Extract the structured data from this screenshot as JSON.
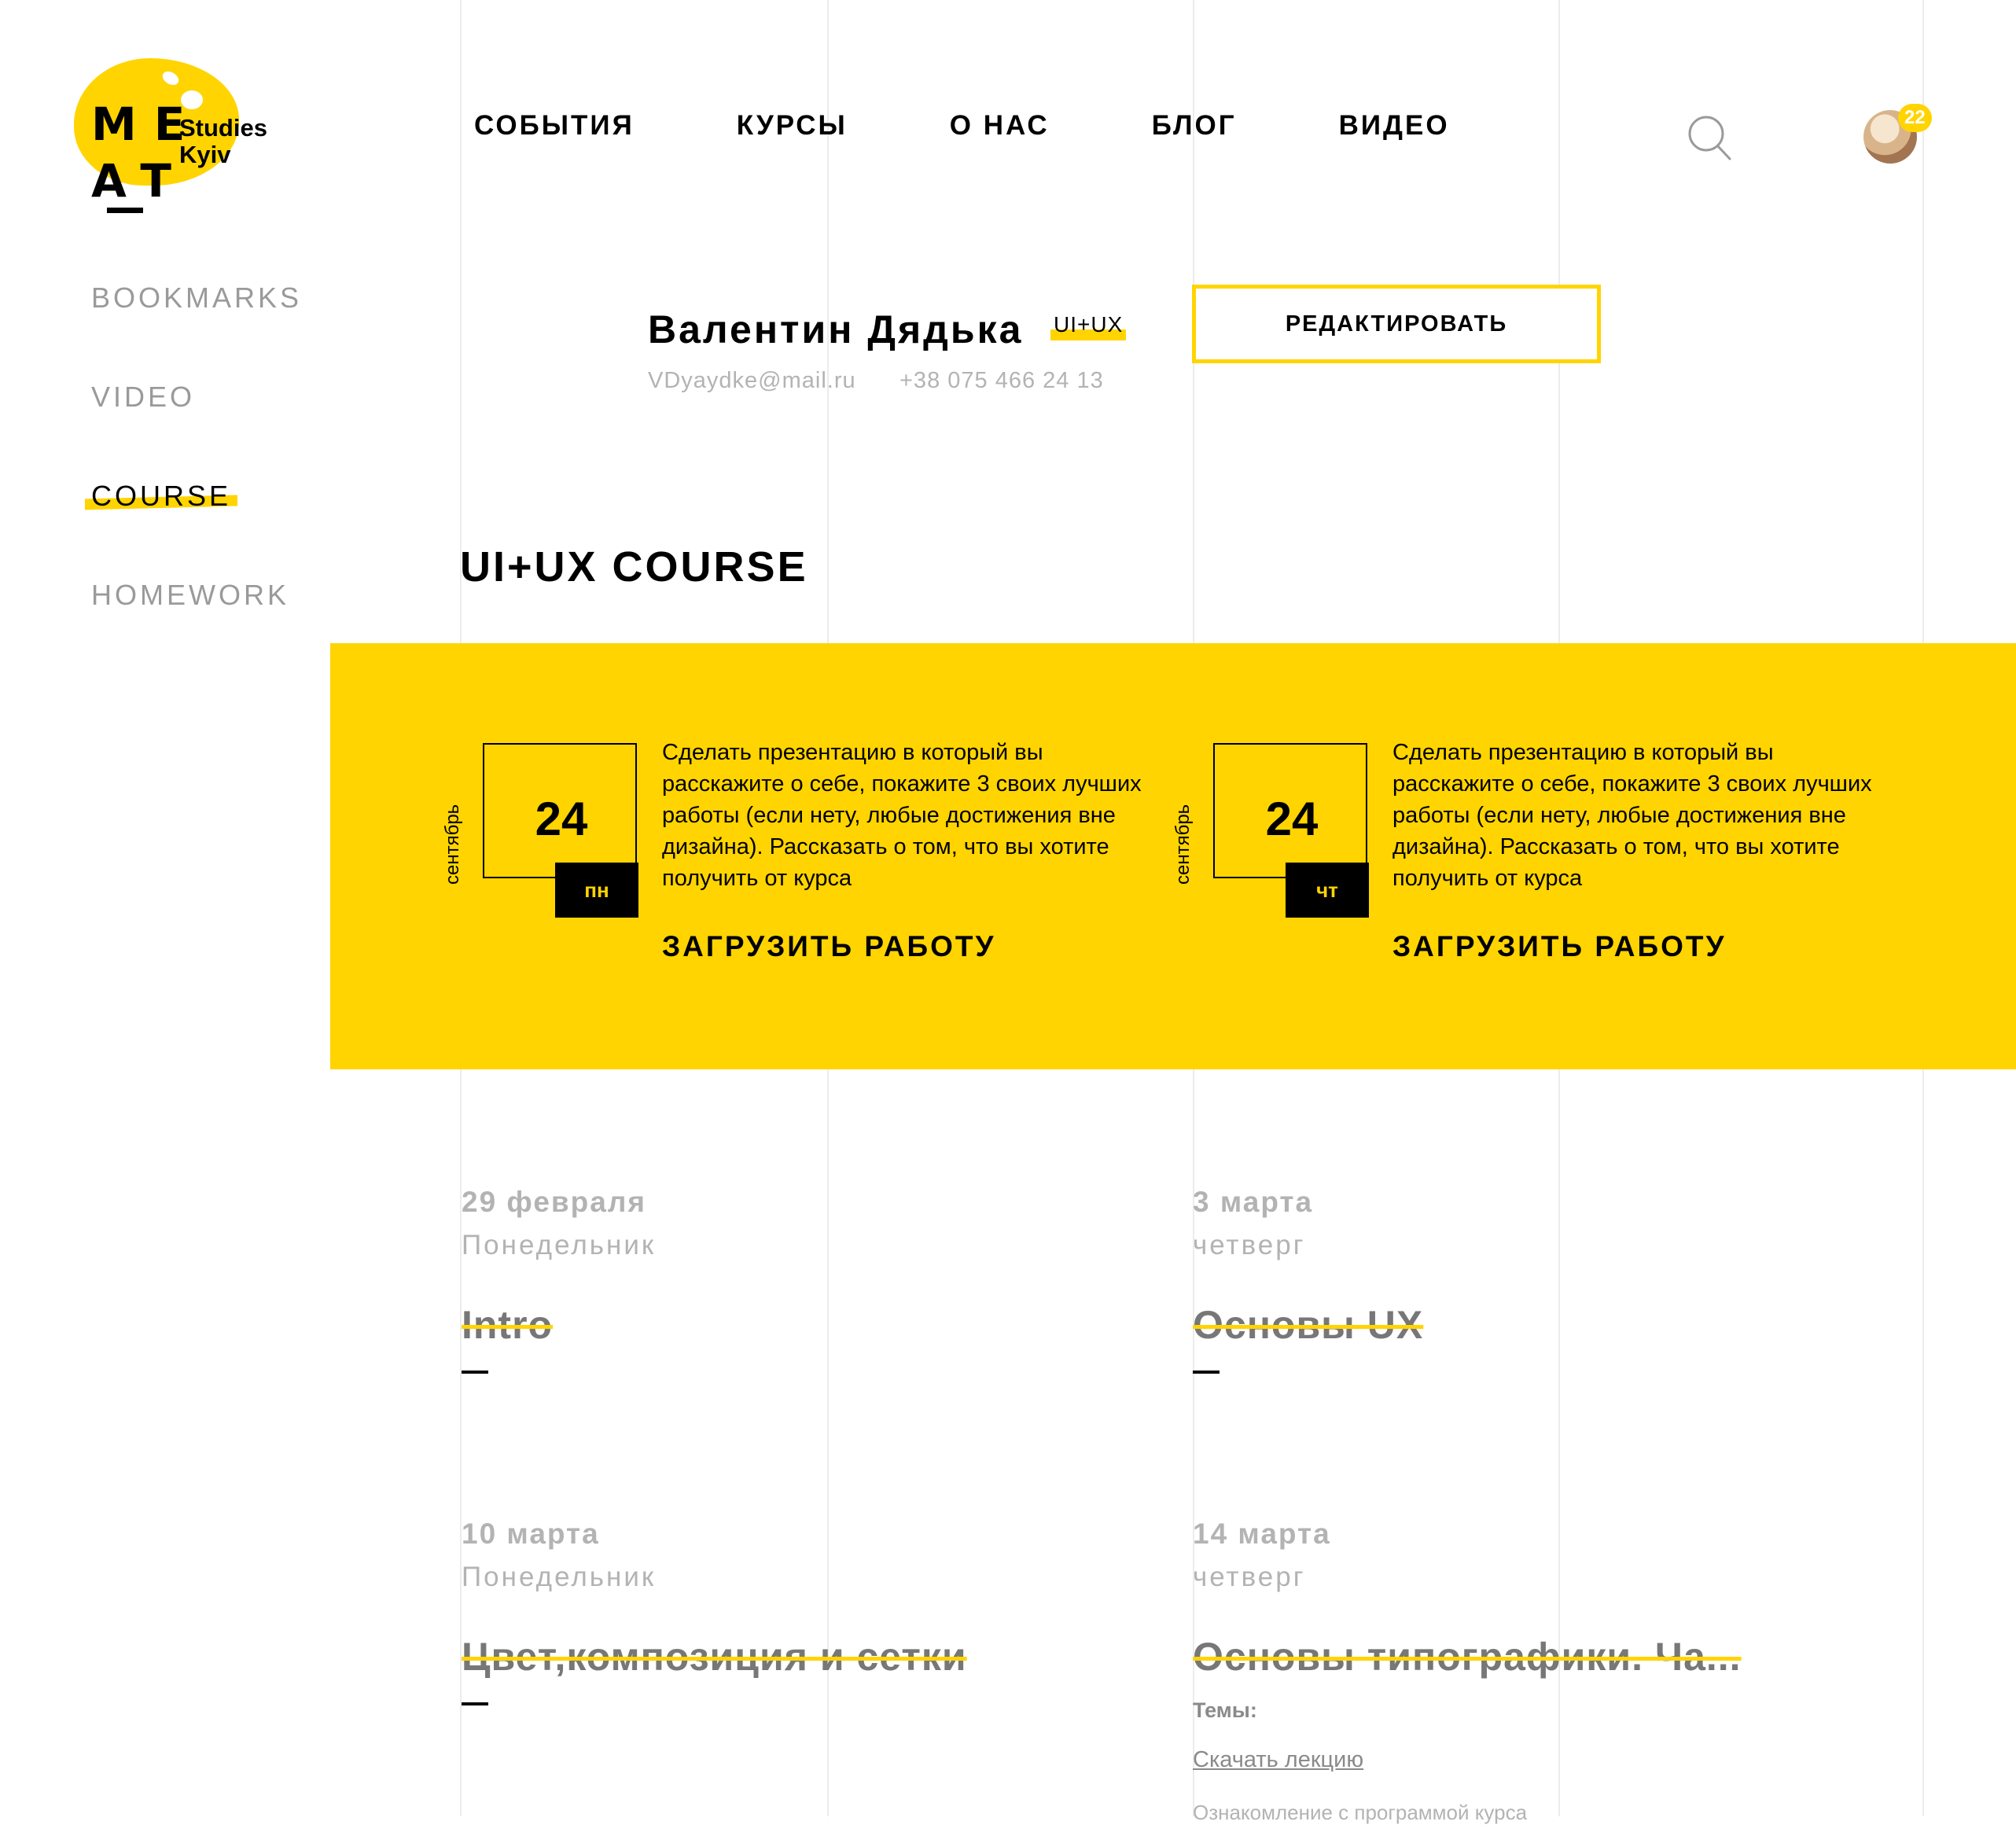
{
  "logo": {
    "letters_top": "ME",
    "letters_bottom": "AT",
    "studies": "Studies",
    "city": "Kyiv"
  },
  "nav": [
    "СОБЫТИЯ",
    "КУРСЫ",
    "О НАС",
    "БЛОГ",
    "ВИДЕО"
  ],
  "header": {
    "search_icon": "search-icon",
    "notifications": "22"
  },
  "sidebar": [
    {
      "label": "BOOKMARKS",
      "active": false
    },
    {
      "label": "VIDEO",
      "active": false
    },
    {
      "label": "COURSE",
      "active": true
    },
    {
      "label": "HOMEWORK",
      "active": false
    }
  ],
  "profile": {
    "name": "Валентин Дядька",
    "tag": "UI+UX",
    "email": "VDyaydke@mail.ru",
    "phone": "+38 075 466 24 13",
    "edit_label": "РЕДАКТИРОВАТЬ"
  },
  "course_title": "UI+UX COURSE",
  "homework": [
    {
      "month": "сентябрь",
      "day": "24",
      "weekday": "пн",
      "description": "Сделать презентацию в который вы расскажите о себе, покажите 3 своих лучших работы (если нету, любые достижения вне дизайна). Рассказать о том, что вы хотите получить от курса",
      "upload_label": "ЗАГРУЗИТЬ РАБОТУ"
    },
    {
      "month": "сентябрь",
      "day": "24",
      "weekday": "чт",
      "description": "Сделать презентацию в который вы расскажите о себе, покажите 3 своих лучших работы (если нету, любые достижения вне дизайна). Рассказать о том, что вы хотите получить от курса",
      "upload_label": "ЗАГРУЗИТЬ РАБОТУ"
    }
  ],
  "lectures": [
    {
      "date": "29 февраля",
      "weekday": "Понедельник",
      "title": "Intro"
    },
    {
      "date": "3 марта",
      "weekday": "четверг",
      "title": "Основы UX"
    },
    {
      "date": "10 марта",
      "weekday": "Понедельник",
      "title": "Цвет,композиция и сетки"
    },
    {
      "date": "14 марта",
      "weekday": "четверг",
      "title": "Основы типографики. Ча..."
    }
  ],
  "lecture_details": {
    "themes_label": "Темы:",
    "download_label": "Скачать лекцию",
    "intro_text": "Ознакомление с программой курса"
  },
  "colors": {
    "accent": "#FFD400",
    "text": "#000000",
    "muted": "#b3b3b3",
    "gridline": "#ececec"
  }
}
